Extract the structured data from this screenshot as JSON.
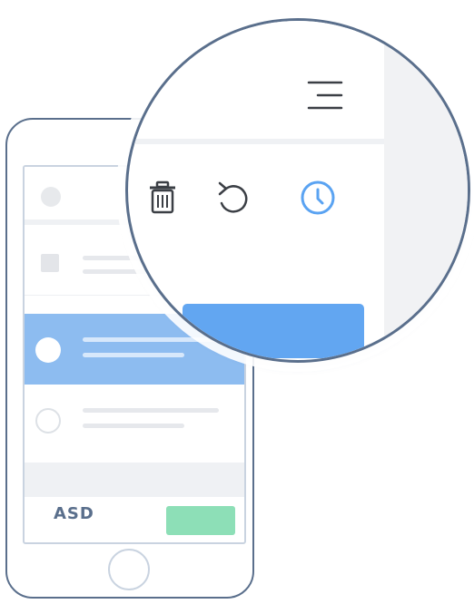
{
  "phone": {
    "list": [
      {
        "type": "checkbox",
        "selected": false
      },
      {
        "type": "radio",
        "selected": true
      },
      {
        "type": "radio",
        "selected": false
      }
    ],
    "footer_label": "ASD",
    "footer_button_label": ""
  },
  "magnifier": {
    "menu_icon": "menu-icon",
    "toolbar": [
      {
        "icon": "trash-icon"
      },
      {
        "icon": "undo-icon"
      },
      {
        "icon": "clock-icon",
        "active": true
      }
    ]
  },
  "colors": {
    "accent_blue": "#62a6f1",
    "selected_row": "#8dbcf0",
    "green": "#8ddfb7",
    "outline": "#5a6f8c"
  }
}
